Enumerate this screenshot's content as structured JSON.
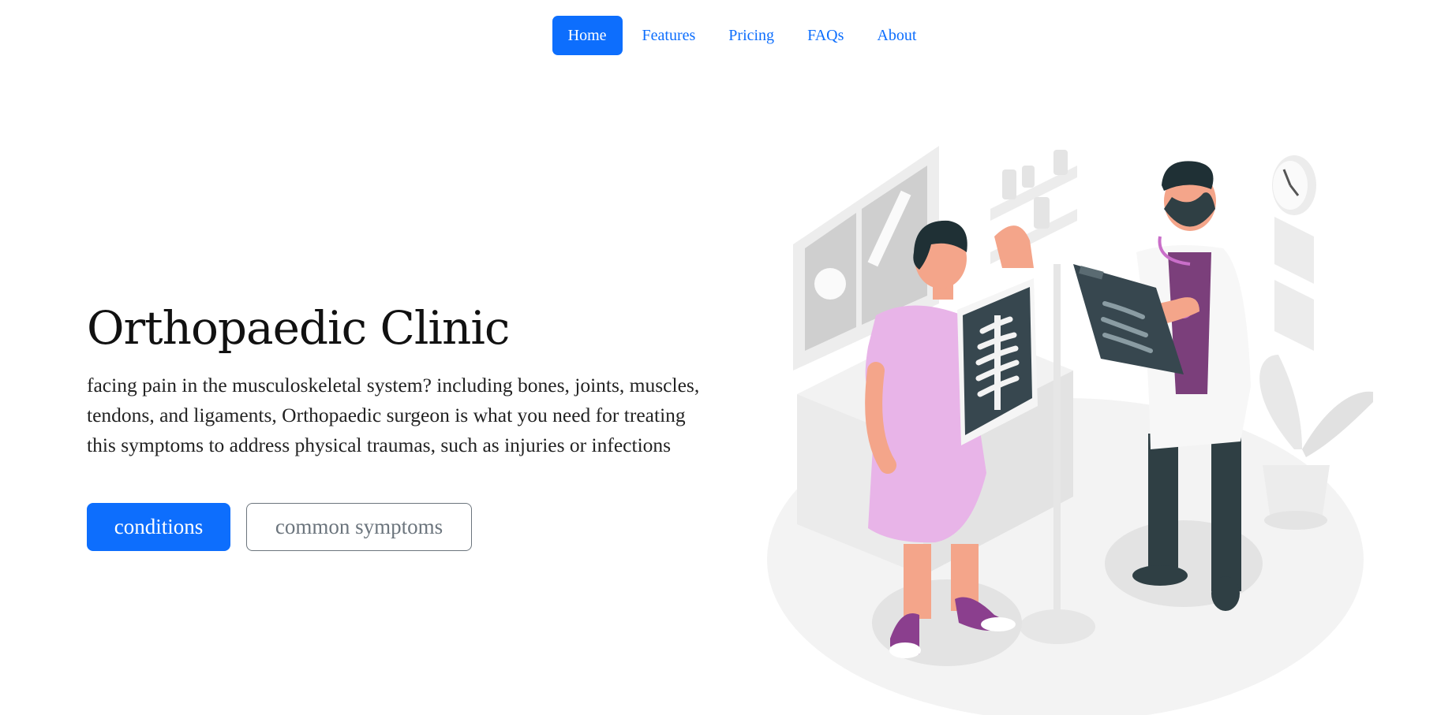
{
  "nav": {
    "items": [
      {
        "label": "Home",
        "active": true
      },
      {
        "label": "Features",
        "active": false
      },
      {
        "label": "Pricing",
        "active": false
      },
      {
        "label": "FAQs",
        "active": false
      },
      {
        "label": "About",
        "active": false
      }
    ]
  },
  "hero": {
    "title": "Orthopaedic Clinic",
    "description": "facing pain in the musculoskeletal system? including bones, joints, muscles, tendons, and ligaments, Orthopaedic surgeon is what you need for treating this symptoms to address physical traumas, such as injuries or infections",
    "primary_button": "conditions",
    "secondary_button": "common symptoms"
  },
  "colors": {
    "accent": "#0d6efd",
    "gown": "#e8b4e8",
    "xray": "#37474f",
    "doctor_shirt": "#7b3f7b"
  }
}
